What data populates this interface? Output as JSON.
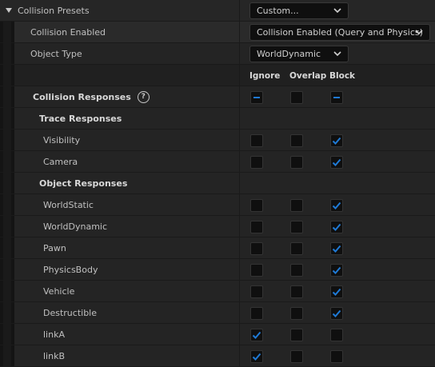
{
  "collision_presets": {
    "label": "Collision Presets",
    "value": "Custom..."
  },
  "collision_enabled": {
    "label": "Collision Enabled",
    "value": "Collision Enabled (Query and Physics)"
  },
  "object_type": {
    "label": "Object Type",
    "value": "WorldDynamic"
  },
  "columns": {
    "ignore": "Ignore",
    "overlap": "Overlap",
    "block": "Block"
  },
  "collision_responses": {
    "label": "Collision Responses",
    "help_glyph": "?",
    "ignore": "mixed",
    "overlap": "off",
    "block": "mixed"
  },
  "trace_responses": {
    "label": "Trace Responses",
    "rows": [
      {
        "name": "Visibility",
        "ignore": false,
        "overlap": false,
        "block": true
      },
      {
        "name": "Camera",
        "ignore": false,
        "overlap": false,
        "block": true
      }
    ]
  },
  "object_responses": {
    "label": "Object Responses",
    "rows": [
      {
        "name": "WorldStatic",
        "ignore": false,
        "overlap": false,
        "block": true
      },
      {
        "name": "WorldDynamic",
        "ignore": false,
        "overlap": false,
        "block": true
      },
      {
        "name": "Pawn",
        "ignore": false,
        "overlap": false,
        "block": true
      },
      {
        "name": "PhysicsBody",
        "ignore": false,
        "overlap": false,
        "block": true
      },
      {
        "name": "Vehicle",
        "ignore": false,
        "overlap": false,
        "block": true
      },
      {
        "name": "Destructible",
        "ignore": false,
        "overlap": false,
        "block": true
      },
      {
        "name": "linkA",
        "ignore": true,
        "overlap": false,
        "block": false
      },
      {
        "name": "linkB",
        "ignore": true,
        "overlap": false,
        "block": false
      }
    ]
  },
  "colors": {
    "accent": "#1f7ad6",
    "text": "#c0c0c0"
  }
}
